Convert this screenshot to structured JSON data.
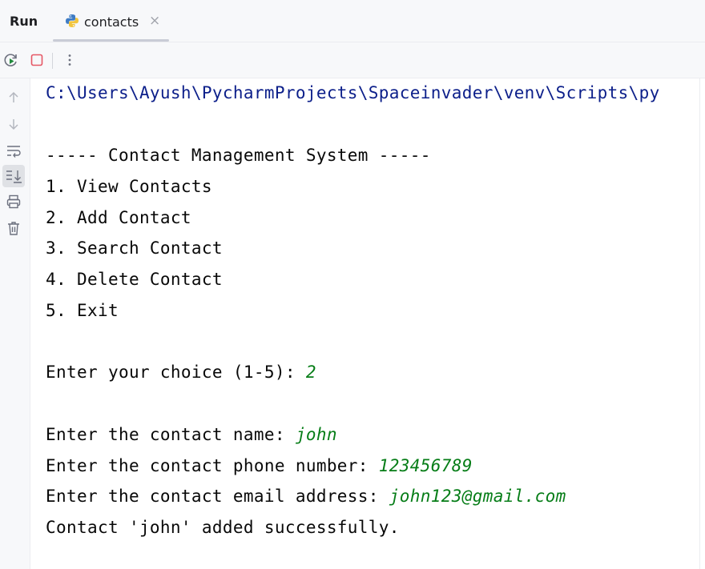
{
  "header": {
    "run_label": "Run",
    "tab": {
      "label": "contacts",
      "close_glyph": "×",
      "icon": "python-icon"
    }
  },
  "toolbar": {
    "icons": [
      "rerun-icon",
      "stop-icon",
      "more-vertical-icon"
    ]
  },
  "gutter": {
    "icons": [
      "arrow-up-icon",
      "arrow-down-icon",
      "soft-wrap-icon",
      "scroll-to-end-icon",
      "print-icon",
      "trash-icon"
    ]
  },
  "console": {
    "path": "C:\\Users\\Ayush\\PycharmProjects\\Spaceinvader\\venv\\Scripts\\py",
    "menu_title": "----- Contact Management System -----",
    "menu_items": [
      "1. View Contacts",
      "2. Add Contact",
      "3. Search Contact",
      "4. Delete Contact",
      "5. Exit"
    ],
    "choice_prompt": "Enter your choice (1-5): ",
    "choice_value": "2",
    "name_prompt": "Enter the contact name: ",
    "name_value": "john",
    "phone_prompt": "Enter the contact phone number: ",
    "phone_value": "123456789",
    "email_prompt": "Enter the contact email address: ",
    "email_value": "john123@gmail.com",
    "result": "Contact 'john' added successfully."
  },
  "colors": {
    "path_text": "#0c1f8a",
    "user_input": "#067d17",
    "stop_red": "#e55765",
    "rerun_green": "#208a3c"
  }
}
